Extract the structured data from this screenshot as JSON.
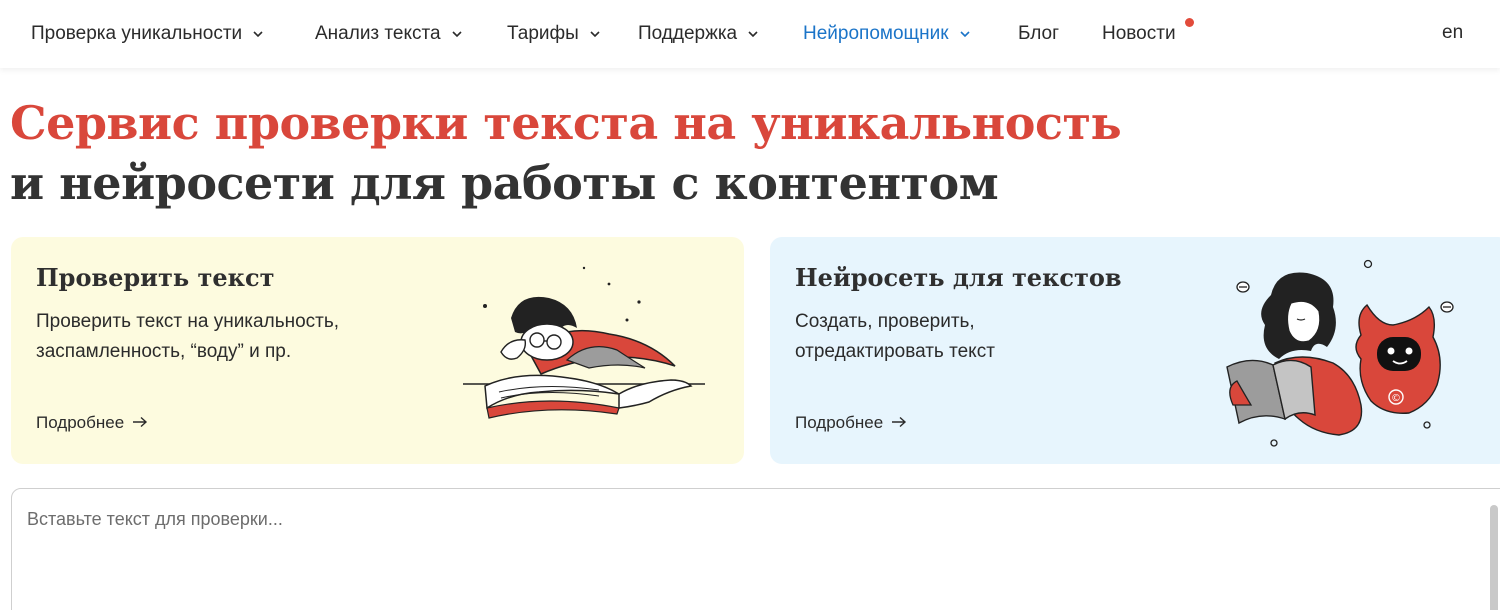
{
  "nav": {
    "items": [
      {
        "label": "Проверка уникальности",
        "has_dropdown": true,
        "active": false
      },
      {
        "label": "Анализ текста",
        "has_dropdown": true,
        "active": false
      },
      {
        "label": "Тарифы",
        "has_dropdown": true,
        "active": false
      },
      {
        "label": "Поддержка",
        "has_dropdown": true,
        "active": false
      },
      {
        "label": "Нейропомощник",
        "has_dropdown": true,
        "active": true
      },
      {
        "label": "Блог",
        "has_dropdown": false,
        "active": false
      },
      {
        "label": "Новости",
        "has_dropdown": false,
        "active": false,
        "badge": "red-dot"
      }
    ],
    "lang": "en",
    "active_color": "#1b74c8",
    "badge_color": "#e24b3b"
  },
  "hero": {
    "line1": "Сервис проверки текста на уникальность",
    "line2": "и нейросети для работы с контентом",
    "line1_color": "#d9473b",
    "line2_color": "#333333"
  },
  "cards": [
    {
      "title": "Проверить текст",
      "desc_line1": "Проверить текст на уникальность,",
      "desc_line2": "заспамленность, “воду” и пр.",
      "link": "Подробнее",
      "bg": "#fdfbdf",
      "illustration": "reader-with-glasses-icon"
    },
    {
      "title": "Нейросеть для текстов",
      "desc_line1": "Создать, проверить,",
      "desc_line2": "отредактировать текст",
      "link": "Подробнее",
      "bg": "#e7f5fd",
      "illustration": "woman-with-robot-icon"
    }
  ],
  "input": {
    "placeholder": "Вставьте текст для проверки...",
    "value": ""
  }
}
